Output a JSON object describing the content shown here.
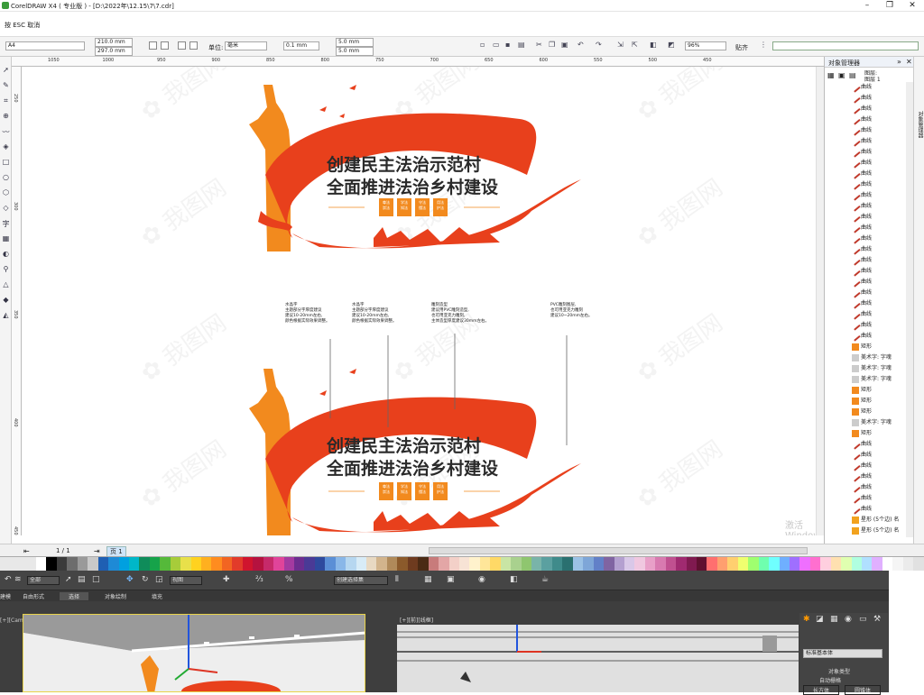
{
  "titlebar": {
    "title": "CorelDRAW X4 ( 专业版 ) - [D:\\2022年\\12.15\\7\\7.cdr]",
    "minimize": "–",
    "maximize": "❐",
    "close": "✕"
  },
  "menubar": {
    "hint": "按 ESC 取消"
  },
  "propbar": {
    "paper": "A4",
    "width": "210.0 mm",
    "height": "297.0 mm",
    "units_label": "单位:",
    "units": "毫米",
    "nudge": "0.1 mm",
    "dup_x": "5.0 mm",
    "dup_y": "5.0 mm",
    "zoom": "96%",
    "snap": "贴齐"
  },
  "ruler_top": [
    "1050",
    "1000",
    "950",
    "900",
    "850",
    "800",
    "750",
    "700",
    "650",
    "600",
    "550",
    "500",
    "450"
  ],
  "ruler_left": [
    "250",
    "300",
    "350",
    "400",
    "450"
  ],
  "design": {
    "title_line1": "创建民主法治示范村",
    "title_line2": "全面推进法治乡村建设",
    "boxes": [
      "尊法\n崇法",
      "学法\n知法",
      "守法\n懂法",
      "用法\n护法"
    ],
    "note1": "水晶字\n主题部分字厚度建议\n建议10-20mm左右,\n颜色根据实际效果调整。",
    "note2": "水晶字\n主题部分字厚度建议\n建议10-20mm左右,\n颜色根据实际效果调整。",
    "note3": "雕刻造型\n建议用PVC雕刻造型,\n也可用亚克力雕刻,\n主体造型厚度建议30mm左右。",
    "note4": "PVC雕刻图层,\n也可用亚克力雕刻\n建议10~20mm左右。"
  },
  "docker": {
    "title": "对象管理器",
    "layer": "图层:",
    "layer_name": "图层 1",
    "items": [
      "曲线",
      "曲线",
      "曲线",
      "曲线",
      "曲线",
      "曲线",
      "曲线",
      "曲线",
      "曲线",
      "曲线",
      "曲线",
      "曲线",
      "曲线",
      "曲线",
      "曲线",
      "曲线",
      "曲线",
      "曲线",
      "曲线",
      "曲线",
      "曲线",
      "曲线",
      "曲线",
      "曲线",
      "矩形",
      "美术字: 字魂",
      "美术字: 字魂",
      "美术字: 字魂",
      "矩形",
      "矩形",
      "矩形",
      "美术字: 字魂",
      "矩形",
      "曲线",
      "曲线",
      "曲线",
      "曲线",
      "曲线",
      "曲线",
      "曲线",
      "星形 (5个边) 名",
      "星形 (5个边) 名"
    ],
    "tab": "对象管理器"
  },
  "watermark": {
    "line1": "激活 Windows",
    "line2": "转到\"设置\"以激活 Windows。"
  },
  "statusbar": {
    "page_count": "1 / 1",
    "page_tab": "页 1"
  },
  "palette": [
    "#ffffff",
    "#000000",
    "#3b3b3b",
    "#6d6d6d",
    "#9a9a9a",
    "#c9c9c9",
    "#1f5fb3",
    "#1e8ad6",
    "#00a0e0",
    "#00b7c8",
    "#0f8c5a",
    "#16a34a",
    "#55b93a",
    "#a7cc3a",
    "#e8e04a",
    "#ffd21f",
    "#ffb01f",
    "#ff8c1f",
    "#f26522",
    "#e23b2a",
    "#d0142e",
    "#b5123f",
    "#c62a6a",
    "#e0449a",
    "#a43aa0",
    "#6c2d8f",
    "#4a3a96",
    "#2e4a9e",
    "#5b8fd6",
    "#89b7e8",
    "#b6d7f0",
    "#d8ecf7",
    "#e8d9c2",
    "#d2b48c",
    "#b08a5a",
    "#8b5a2b",
    "#6e3b1f",
    "#4a2a14",
    "#c87b7b",
    "#e3a6a6",
    "#f3d0c8",
    "#f7e3d5",
    "#fff2cc",
    "#ffe699",
    "#ffd966",
    "#c9e5a4",
    "#a9d18e",
    "#8fc66f",
    "#79b4a9",
    "#5ba0a0",
    "#3f8b8b",
    "#2a7070",
    "#9bc2e6",
    "#7ea6d8",
    "#6280c8",
    "#8064a2",
    "#b4a0d0",
    "#d9c8e8",
    "#f0c8e0",
    "#e8a0c8",
    "#d87ab0",
    "#c05090",
    "#a02a70",
    "#801a50",
    "#601030",
    "#ff6f6f",
    "#ff9f6f",
    "#ffcf6f",
    "#efff6f",
    "#9fff6f",
    "#6fffaf",
    "#6fffff",
    "#6fafff",
    "#9f6fff",
    "#ef6fff",
    "#ff6fcf",
    "#ffcfdf",
    "#ffe0b0",
    "#e0ffb0",
    "#b0ffe0",
    "#b0e0ff",
    "#e0b0ff",
    "#ffffff",
    "#f5f5f5",
    "#ebebeb",
    "#e1e1e1"
  ],
  "max": {
    "select_all": "全部",
    "view": "视图",
    "selection_set": "创建选择集",
    "ribbon": [
      "建模",
      "自由形式",
      "选择",
      "对象绘制",
      "填充"
    ],
    "vp1_label": "[+][Camera001][真实]",
    "vp2_label": "[+][前][线框]",
    "cmd_dropdown": "标准基本体",
    "obj_type": "对象类型",
    "autogrid": "自动栅格",
    "btn1": "长方体",
    "btn2": "圆锥体"
  },
  "colors": {
    "orange": "#f28a1e",
    "red": "#e8401c",
    "dark": "#2a2a2a"
  }
}
